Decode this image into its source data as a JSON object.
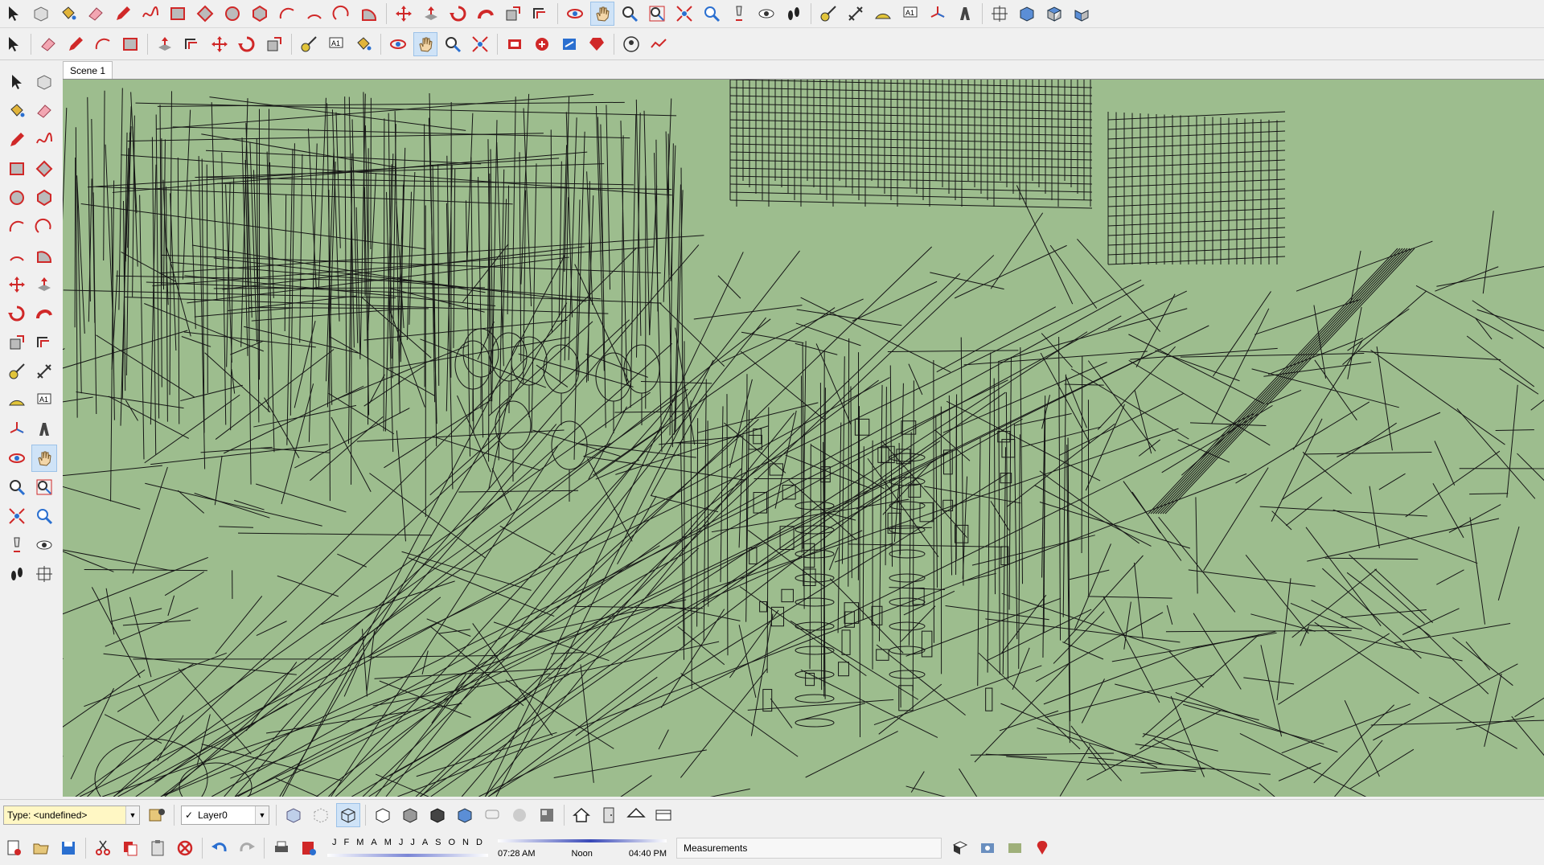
{
  "scene": {
    "tab_label": "Scene 1"
  },
  "status_bar": {
    "type_label": "Type: <undefined>",
    "layer_label": "Layer0",
    "months": [
      "J",
      "F",
      "M",
      "A",
      "M",
      "J",
      "J",
      "A",
      "S",
      "O",
      "N",
      "D"
    ],
    "time_start": "07:28 AM",
    "time_mid": "Noon",
    "time_end": "04:40 PM",
    "measurements_label": "Measurements"
  },
  "colors": {
    "viewport_bg": "#9dbd8e",
    "toolbar_bg": "#f0f0f0",
    "active_tool_bg": "#cfe3f7",
    "tool_red": "#d02828",
    "tool_blue": "#2a6fd0"
  },
  "toolbars": {
    "top_row_1": [
      "select-icon",
      "component-icon",
      "paint-bucket-icon",
      "eraser-icon",
      "pencil-icon",
      "freehand-icon",
      "rectangle-icon",
      "rotated-rectangle-icon",
      "circle-icon",
      "polygon-icon",
      "arc-icon",
      "two-point-arc-icon",
      "three-point-arc-icon",
      "pie-icon",
      "move-icon",
      "push-pull-icon",
      "rotate-icon",
      "follow-me-icon",
      "scale-icon",
      "offset-icon",
      "orbit-icon",
      "pan-icon",
      "zoom-icon",
      "zoom-window-icon",
      "zoom-extents-icon",
      "previous-view-icon",
      "position-camera-icon",
      "look-around-icon",
      "walk-icon",
      "tape-measure-icon",
      "dimension-icon",
      "protractor-icon",
      "text-icon",
      "axes-icon",
      "3d-text-icon",
      "section-plane-icon",
      "iso-view-icon",
      "top-view-icon",
      "front-view-icon"
    ],
    "top_row_2": [
      "select-icon",
      "eraser-icon",
      "pencil-icon",
      "arc-icon",
      "rectangle-icon",
      "push-pull-icon",
      "offset-icon",
      "move-icon",
      "rotate-icon",
      "scale-icon",
      "tape-measure-icon",
      "text-icon",
      "paint-bucket-icon",
      "orbit-icon",
      "pan-icon",
      "zoom-icon",
      "zoom-extents-icon",
      "warehouse-icon",
      "extension-warehouse-icon",
      "layout-icon",
      "ruby-icon",
      "user-icon",
      "sandbox-tools-icon"
    ],
    "left": [
      "select-icon",
      "component-icon",
      "paint-bucket-icon",
      "eraser-icon",
      "pencil-icon",
      "freehand-icon",
      "rectangle-icon",
      "rotated-rectangle-icon",
      "circle-icon",
      "polygon-icon",
      "arc-icon",
      "three-point-arc-icon",
      "two-point-arc-icon",
      "pie-icon",
      "move-icon",
      "push-pull-icon",
      "rotate-icon",
      "follow-me-icon",
      "scale-icon",
      "offset-icon",
      "tape-measure-icon",
      "dimension-icon",
      "protractor-icon",
      "text-icon",
      "axes-icon",
      "3d-text-icon",
      "orbit-icon",
      "pan-icon",
      "zoom-icon",
      "zoom-window-icon",
      "zoom-extents-icon",
      "previous-view-icon",
      "position-camera-icon",
      "look-around-icon",
      "walk-icon",
      "section-plane-icon"
    ],
    "bottom_row_1": [
      "xray-icon",
      "back-edges-icon",
      "wireframe-icon",
      "hidden-line-icon",
      "shaded-icon",
      "textured-icon",
      "monochrome-icon",
      "shadows-icon",
      "fog-icon",
      "styles-icon",
      "house-icon",
      "door-icon",
      "roof-icon",
      "section-icon"
    ],
    "bottom_row_2": [
      "new-icon",
      "open-icon",
      "save-icon",
      "cut-icon",
      "copy-icon",
      "paste-icon",
      "delete-icon",
      "undo-icon",
      "redo-icon",
      "print-icon",
      "model-info-icon",
      "shadow-settings-icon",
      "geo-location-icon",
      "photo-textures-icon",
      "add-location-icon"
    ]
  }
}
